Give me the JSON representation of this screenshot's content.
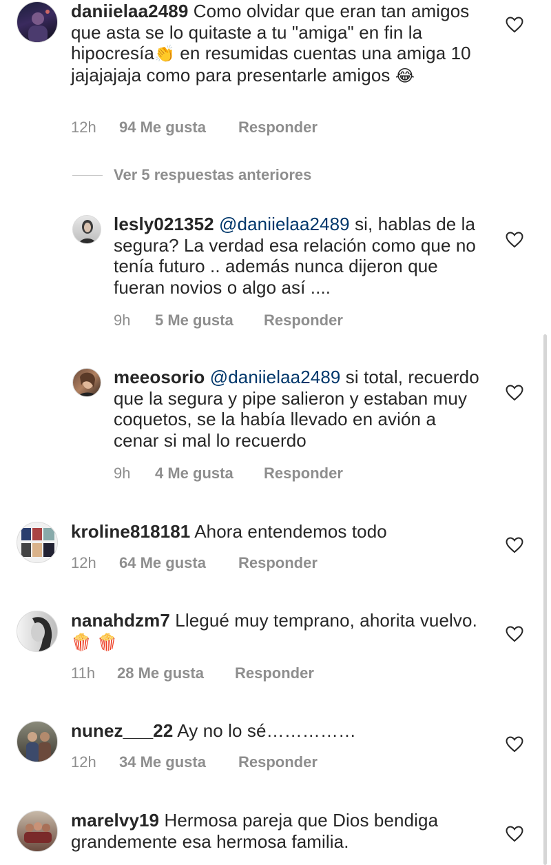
{
  "comments": [
    {
      "username": "daniielaa2489",
      "text": "Como olvidar que eran tan amigos que asta se lo quitaste a tu \"amiga\" en fin la hipocresía",
      "emoji1": "👏",
      "text2": "en resumidas cuentas una amiga 10 jajajajaja como para presentarle amigos",
      "emoji2": "😂",
      "time": "12h",
      "likes": "94 Me gusta",
      "reply": "Responder"
    },
    {
      "username": "kroline818181",
      "text": "Ahora entendemos todo",
      "time": "12h",
      "likes": "64 Me gusta",
      "reply": "Responder"
    },
    {
      "username": "nanahdzm7",
      "text": "Llegué muy temprano, ahorita vuelvo.",
      "emoji": "🍿 🍿",
      "time": "11h",
      "likes": "28 Me gusta",
      "reply": "Responder"
    },
    {
      "username": "nunez___22",
      "text": "Ay no lo sé……………",
      "time": "12h",
      "likes": "34 Me gusta",
      "reply": "Responder"
    },
    {
      "username": "marelvy19",
      "text": "Hermosa pareja que Dios bendiga grandemente esa hermosa familia."
    }
  ],
  "view_previous": "Ver 5 respuestas anteriores",
  "replies": [
    {
      "username": "lesly021352",
      "mention": "@daniielaa2489",
      "text": "si, hablas de la segura? La verdad esa relación como que no tenía futuro .. además nunca dijeron que fueran novios o algo así ....",
      "time": "9h",
      "likes": "5 Me gusta",
      "reply": "Responder"
    },
    {
      "username": "meeosorio",
      "mention": "@daniielaa2489",
      "text": " si total, recuerdo que la segura y pipe salieron y estaban muy coquetos, se la había llevado en avión a cenar si mal lo recuerdo",
      "time": "9h",
      "likes": "4 Me gusta",
      "reply": "Responder"
    }
  ],
  "icons": {
    "like": "heart-outline-icon"
  },
  "colors": {
    "text": "#262626",
    "secondary": "#8e8e8e",
    "mention": "#00376b"
  }
}
